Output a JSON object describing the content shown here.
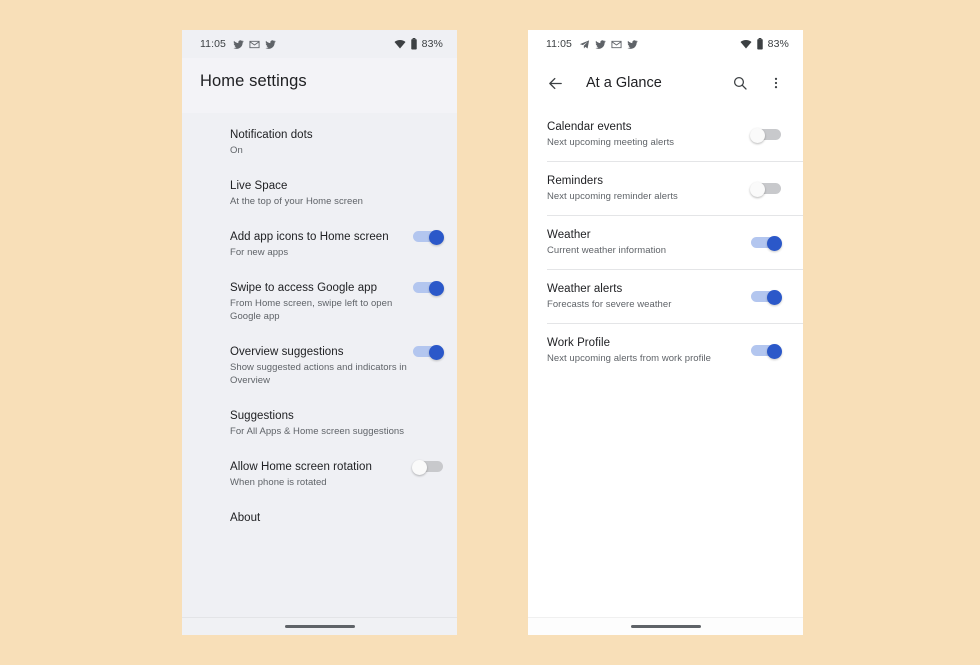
{
  "theme": {
    "page_background": "#f8dfb8",
    "accent_on": "#2b58c9",
    "accent_track_on": "#b3c6ef",
    "track_off": "#c8c9cc",
    "text_primary": "#202124",
    "text_secondary": "#5f6368"
  },
  "left_phone": {
    "statusbar": {
      "time": "11:05",
      "icons": [
        "twitter-icon",
        "gmail-icon",
        "twitter-icon"
      ],
      "wifi": "wifi-icon",
      "battery": "battery-icon",
      "battery_level": "83%"
    },
    "appbar": {
      "title": "Home settings"
    },
    "rows": [
      {
        "title": "Notification dots",
        "subtitle": "On",
        "switch": null
      },
      {
        "title": "Live Space",
        "subtitle": "At the top of your Home screen",
        "switch": null
      },
      {
        "title": "Add app icons to Home screen",
        "subtitle": "For new apps",
        "switch": "on"
      },
      {
        "title": "Swipe to access Google app",
        "subtitle": "From Home screen, swipe left to open Google app",
        "switch": "on"
      },
      {
        "title": "Overview suggestions",
        "subtitle": "Show suggested actions and indicators in Overview",
        "switch": "on"
      },
      {
        "title": "Suggestions",
        "subtitle": "For All Apps & Home screen suggestions",
        "switch": null
      },
      {
        "title": "Allow Home screen rotation",
        "subtitle": "When phone is rotated",
        "switch": "off"
      },
      {
        "title": "About",
        "subtitle": null,
        "switch": null
      }
    ],
    "navbar": {
      "gesture_pill": "gesture-pill"
    }
  },
  "right_phone": {
    "statusbar": {
      "time": "11:05",
      "icons": [
        "telegram-icon",
        "twitter-icon",
        "gmail-icon",
        "twitter-icon"
      ],
      "wifi": "wifi-icon",
      "battery": "battery-icon",
      "battery_level": "83%"
    },
    "appbar": {
      "back": "back-arrow-icon",
      "title": "At a Glance",
      "search": "search-icon",
      "overflow": "more-vert-icon"
    },
    "rows": [
      {
        "title": "Calendar events",
        "subtitle": "Next upcoming meeting alerts",
        "switch": "off"
      },
      {
        "title": "Reminders",
        "subtitle": "Next upcoming reminder alerts",
        "switch": "off"
      },
      {
        "title": "Weather",
        "subtitle": "Current weather information",
        "switch": "on"
      },
      {
        "title": "Weather alerts",
        "subtitle": "Forecasts for severe weather",
        "switch": "on"
      },
      {
        "title": "Work Profile",
        "subtitle": "Next upcoming alerts from work profile",
        "switch": "on"
      }
    ],
    "navbar": {
      "gesture_pill": "gesture-pill"
    }
  }
}
